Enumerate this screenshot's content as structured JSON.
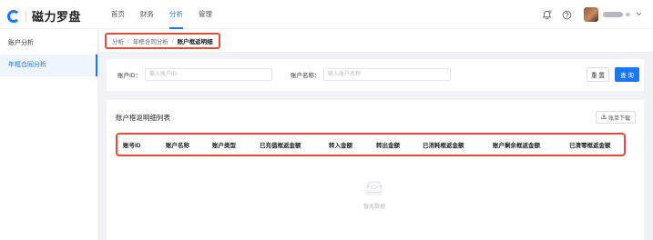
{
  "app": {
    "logo_text": "磁力罗盘"
  },
  "topnav": {
    "items": [
      {
        "label": "首页",
        "active": false
      },
      {
        "label": "财务",
        "active": false
      },
      {
        "label": "分析",
        "active": true
      },
      {
        "label": "管理",
        "active": false
      }
    ]
  },
  "header": {
    "icons": [
      "bell-icon",
      "help-icon"
    ]
  },
  "sidebar": {
    "items": [
      {
        "label": "账户分析",
        "active": false
      },
      {
        "label": "年框合同分析",
        "active": true
      }
    ]
  },
  "breadcrumb": {
    "items": [
      "分析",
      "年框合同分析",
      "账户框返明细"
    ],
    "separator": "/"
  },
  "search": {
    "account_id_label": "账户ID：",
    "account_id_placeholder": "输入账户ID",
    "account_id_value": "",
    "account_name_label": "账户名称：",
    "account_name_placeholder": "输入账户名称",
    "account_name_value": "",
    "reset_label": "重 置",
    "query_label": "查 询"
  },
  "table": {
    "title": "账户框返明细列表",
    "download_label": "账单下载",
    "columns": [
      "账号ID",
      "账户名称",
      "账户类型",
      "已充值框返金额",
      "转入金额",
      "转出金额",
      "已消耗框返金额",
      "账户剩余框返金额",
      "已清零框返金额"
    ],
    "rows": [],
    "empty_text": "暂无数据"
  },
  "colors": {
    "accent": "#1677ff",
    "highlight_border": "#e84a3c",
    "background": "#f0f2f5"
  }
}
